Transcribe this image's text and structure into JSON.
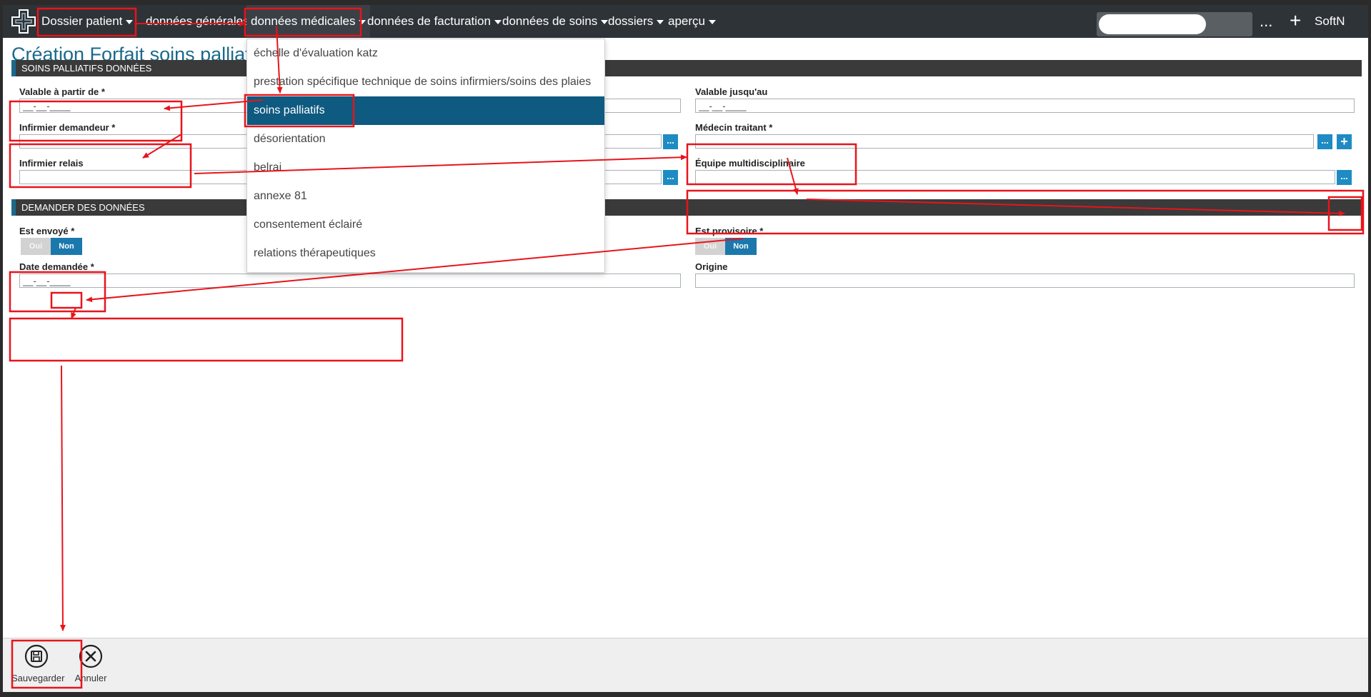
{
  "navbar": {
    "items": [
      {
        "label": "Dossier patient"
      },
      {
        "label": "données générales"
      },
      {
        "label": "données médicales"
      },
      {
        "label": "données de facturation"
      },
      {
        "label": "données de soins"
      },
      {
        "label": "dossiers"
      },
      {
        "label": "aperçu"
      }
    ],
    "search_value": "",
    "more_label": "...",
    "add_label": "+",
    "user_label": "SoftN"
  },
  "dropdown": {
    "items": [
      {
        "label": "échelle d'évaluation katz"
      },
      {
        "label": "prestation spécifique technique de soins infirmiers/soins des plaies"
      },
      {
        "label": "soins palliatifs",
        "selected": true
      },
      {
        "label": "désorientation"
      },
      {
        "label": "belrai"
      },
      {
        "label": "annexe 81"
      },
      {
        "label": "consentement éclairé"
      },
      {
        "label": "relations thérapeutiques"
      }
    ]
  },
  "page": {
    "title": "Création Forfait soins palliatifs"
  },
  "section1": {
    "title": "SOINS PALLIATIFS DONNÉES",
    "valid_from_label": "Valable à partir de *",
    "valid_from_value": "__-__-____",
    "valid_until_label": "Valable jusqu'au",
    "valid_until_value": "__-__-____",
    "requesting_nurse_label": "Infirmier demandeur *",
    "treating_doctor_label": "Médecin traitant *",
    "relay_nurse_label": "Infirmier relais",
    "team_label": "Équipe multidisciplinaire",
    "dots": "...",
    "plus": "+"
  },
  "section2": {
    "title": "DEMANDER DES DONNÉES",
    "sent_label": "Est envoyé *",
    "provisional_label": "Est provisoire *",
    "yes": "Oui",
    "no": "Non",
    "requested_date_label": "Date demandée *",
    "requested_date_value": "__-__-____",
    "origin_label": "Origine"
  },
  "footer": {
    "save_label": "Sauvegarder",
    "cancel_label": "Annuler"
  },
  "colors": {
    "navbar": "#2e3338",
    "accent": "#1b6a8c",
    "selected_menu": "#0e5a80",
    "toggle_on": "#1b78ad",
    "button": "#1e8bc3",
    "annotation": "#e8141b"
  }
}
